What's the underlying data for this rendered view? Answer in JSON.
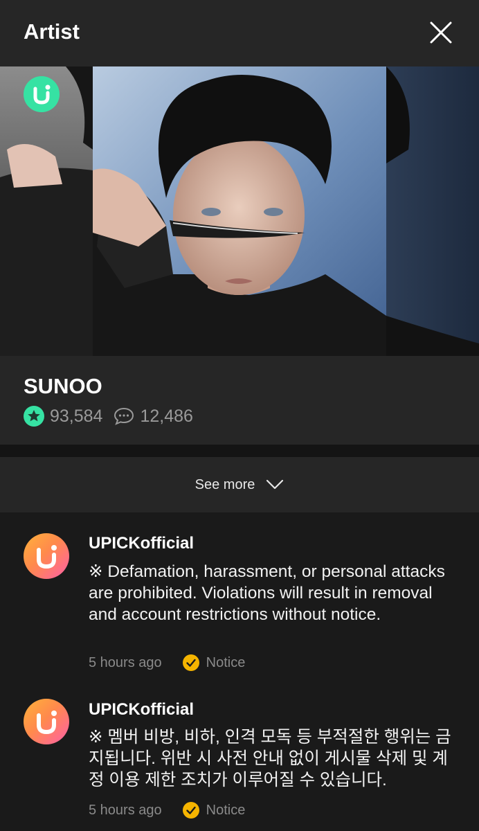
{
  "header": {
    "title": "Artist",
    "close_icon": "close-icon"
  },
  "artist": {
    "name": "SUNOO",
    "votes": "93,584",
    "comments": "12,486",
    "accent": "#36e2a3"
  },
  "see_more": {
    "label": "See more"
  },
  "posts": [
    {
      "author": "UPICKofficial",
      "text": "※ Defamation, harassment, or personal attacks are prohibited. Violations will result in removal and account restrictions without notice.",
      "time": "5 hours ago",
      "tag": "Notice"
    },
    {
      "author": "UPICKofficial",
      "text": "※ 멤버 비방, 비하, 인격 모독 등 부적절한 행위는 금지됩니다.  위반 시 사전 안내 없이 게시물 삭제 및 계정 이용 제한 조치가 이루어질 수 있습니다.",
      "time": "5 hours ago",
      "tag": "Notice"
    }
  ],
  "colors": {
    "background": "#1a1a1a",
    "card": "#262626",
    "notice_badge": "#f5b400"
  }
}
